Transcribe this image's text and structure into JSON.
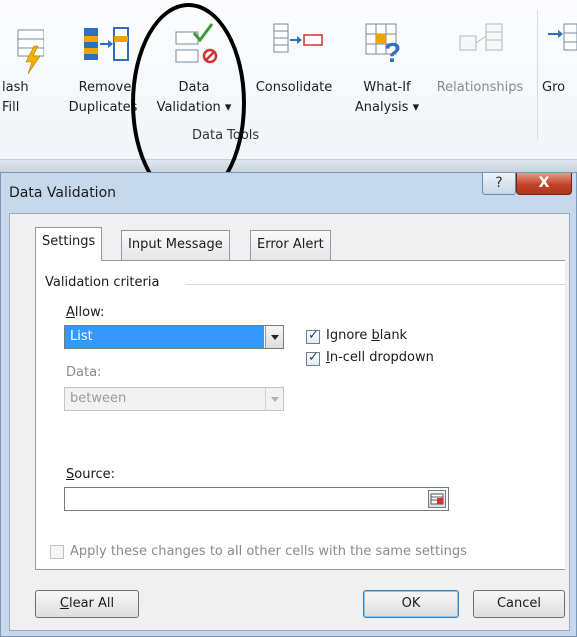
{
  "ribbon": {
    "buttons": [
      {
        "line1": "lash",
        "line2": "Fill",
        "dim": false
      },
      {
        "line1": "Remove",
        "line2": "Duplicates",
        "dim": false
      },
      {
        "line1": "Data",
        "line2": "Validation ▾",
        "dim": false
      },
      {
        "line1": "Consolidate",
        "line2": "",
        "dim": false
      },
      {
        "line1": "What-If",
        "line2": "Analysis ▾",
        "dim": false
      },
      {
        "line1": "Relationships",
        "line2": "",
        "dim": true
      },
      {
        "line1": "Gro",
        "line2": "",
        "dim": false
      }
    ],
    "group_label": "Data Tools"
  },
  "dialog": {
    "title": "Data Validation",
    "help_glyph": "?",
    "close_glyph": "X",
    "tabs": [
      "Settings",
      "Input Message",
      "Error Alert"
    ],
    "section_title": "Validation criteria",
    "allow_label_pre": "",
    "allow_label_key": "A",
    "allow_label_post": "llow:",
    "allow_value": "List",
    "data_label": "Data:",
    "data_value": "between",
    "ignore_blank_pre": "Ignore ",
    "ignore_blank_key": "b",
    "ignore_blank_post": "lank",
    "ignore_blank_checked": true,
    "incell_pre": "",
    "incell_key": "I",
    "incell_post": "n-cell dropdown",
    "incell_checked": true,
    "source_label_key": "S",
    "source_label_post": "ource:",
    "source_value": "",
    "apply_text": "Apply these changes to all other cells with the same settings",
    "apply_checked": false,
    "buttons": {
      "clear_key": "C",
      "clear_post": "lear All",
      "ok": "OK",
      "cancel": "Cancel"
    }
  },
  "colors": {
    "selection": "#3399ff",
    "dialog_frame": "#c6d8eb",
    "close_button": "#c2432a"
  }
}
